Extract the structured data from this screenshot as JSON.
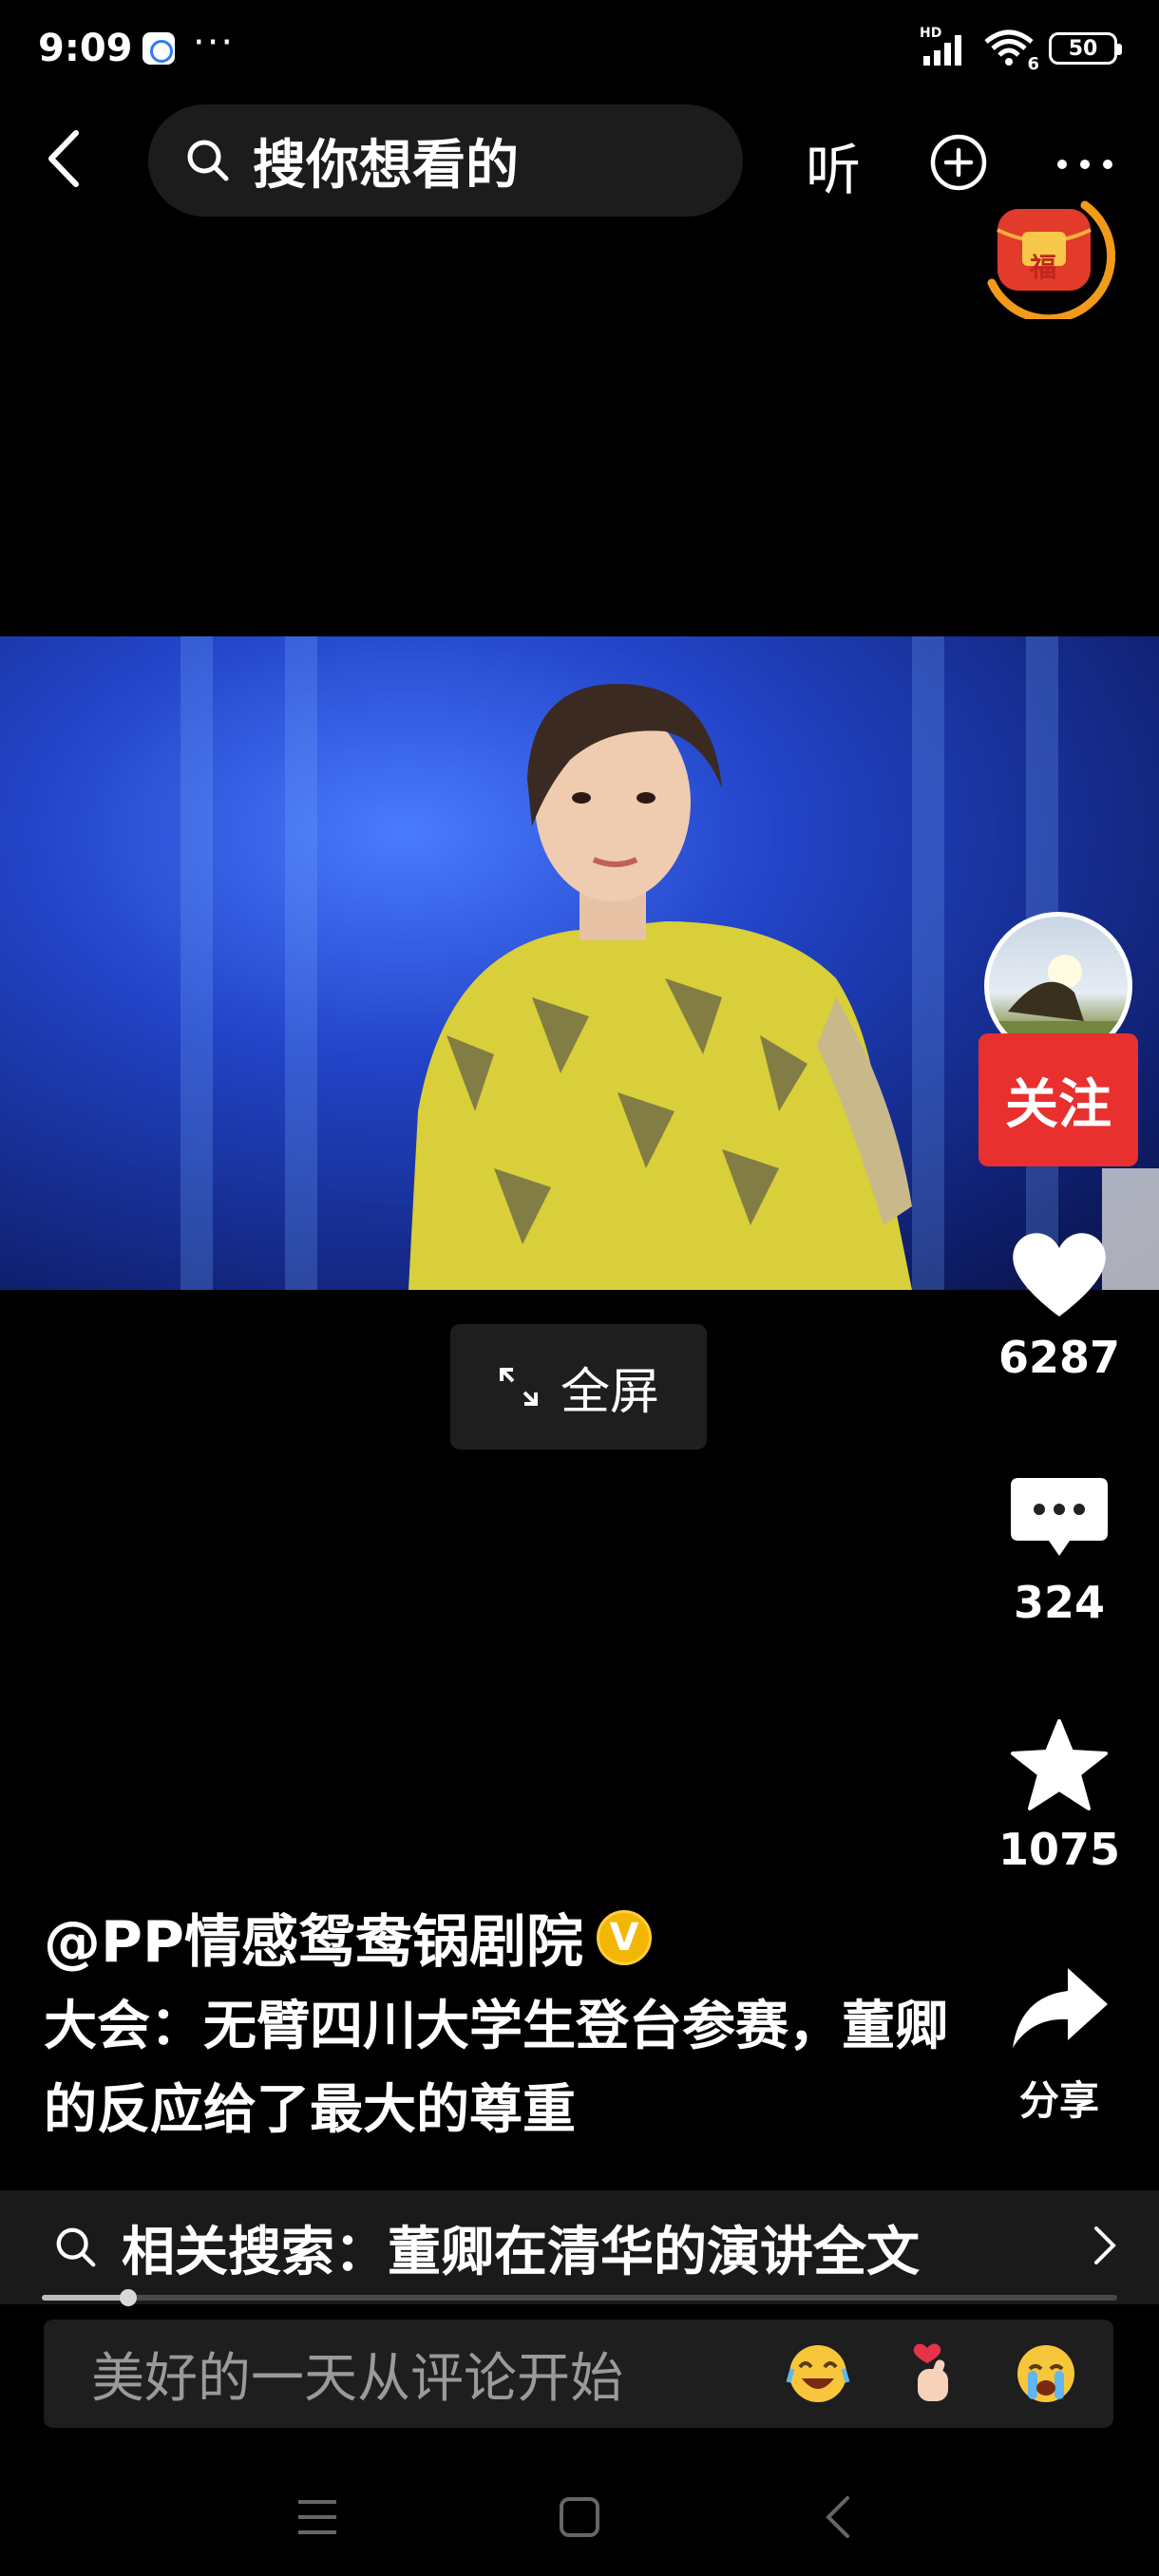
{
  "status_bar": {
    "time": "9:09",
    "app_icon": "notification-app-icon",
    "more_dots": "···",
    "network_label": "HD",
    "wifi_label": "6",
    "battery_level": "50"
  },
  "top_nav": {
    "search_placeholder": "搜你想看的",
    "listen_label": "听",
    "fu_badge_text": "福"
  },
  "video": {
    "fullscreen_label": "全屏"
  },
  "rail": {
    "follow_label": "关注",
    "like_count": "6287",
    "comment_count": "324",
    "favorite_count": "1075",
    "share_label": "分享"
  },
  "post": {
    "author": "@PP情感鸳鸯锅剧院",
    "verified_mark": "V",
    "caption": "大会：无臂四川大学生登台参赛，董卿的反应给了最大的尊重"
  },
  "related": {
    "text": "相关搜索：董卿在清华的演讲全文"
  },
  "progress": {
    "fraction": 0.08
  },
  "comment_box": {
    "placeholder": "美好的一天从评论开始"
  },
  "colors": {
    "follow_red": "#e8302f",
    "verified_gold": "#f2b705",
    "fu_ring_orange": "#f29a1a",
    "background": "#000000"
  }
}
